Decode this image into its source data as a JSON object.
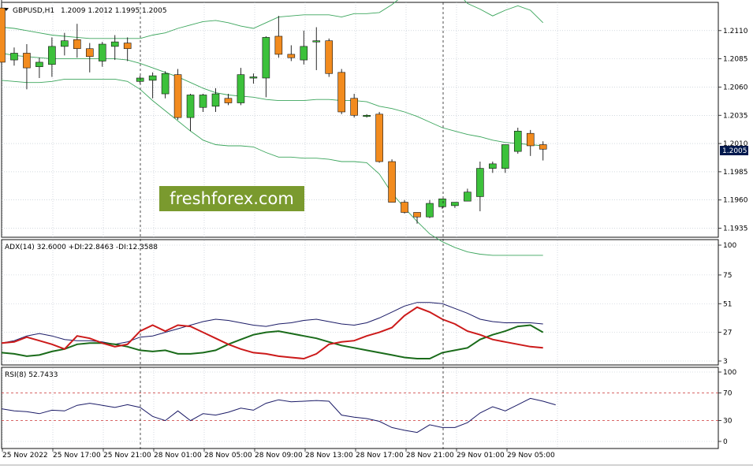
{
  "header": {
    "symbol": "GBPUSD,H1",
    "ohlc": "1.2009 1.2012 1.1995 1.2005"
  },
  "price_panel": {
    "ticks": [
      "1.2110",
      "1.2085",
      "1.2060",
      "1.2035",
      "1.2010",
      "1.1985",
      "1.1960",
      "1.1935"
    ],
    "current_price": "1.2005",
    "watermark": "freshforex.com",
    "colors": {
      "bull": "#3cc13b",
      "bear": "#f28b1e",
      "band": "#3ba55c",
      "current_tag": "#00184d"
    }
  },
  "adx_panel": {
    "label": "ADX(14) 32.6000 +DI:22.8463 -DI:12.3588",
    "ticks": [
      "100",
      "75",
      "51",
      "27",
      "3"
    ],
    "colors": {
      "adx": "#1a1a66",
      "plus_di": "#1a6b1a",
      "minus_di": "#cc1a1a"
    }
  },
  "rsi_panel": {
    "label": "RSI(8) 52.7433",
    "ticks": [
      "100",
      "70",
      "30",
      "0"
    ],
    "levels": [
      70,
      30
    ],
    "colors": {
      "line": "#1a1a66",
      "level": "#cc3333"
    }
  },
  "time_axis": [
    "25 Nov 2022",
    "25 Nov 17:00",
    "25 Nov 21:00",
    "28 Nov 01:00",
    "28 Nov 05:00",
    "28 Nov 09:00",
    "28 Nov 13:00",
    "28 Nov 17:00",
    "28 Nov 21:00",
    "29 Nov 01:00",
    "29 Nov 05:00"
  ],
  "chart_data": {
    "type": "candlestick",
    "price_ylim": [
      1.1927,
      1.2135
    ],
    "candles": [
      {
        "o": 1.213,
        "h": 1.214,
        "l": 1.2075,
        "c": 1.2082
      },
      {
        "o": 1.2084,
        "h": 1.2095,
        "l": 1.2079,
        "c": 1.209
      },
      {
        "o": 1.209,
        "h": 1.2098,
        "l": 1.2058,
        "c": 1.2077
      },
      {
        "o": 1.2078,
        "h": 1.2086,
        "l": 1.2068,
        "c": 1.2082
      },
      {
        "o": 1.208,
        "h": 1.2104,
        "l": 1.2069,
        "c": 1.2096
      },
      {
        "o": 1.2096,
        "h": 1.2108,
        "l": 1.2088,
        "c": 1.2101
      },
      {
        "o": 1.2102,
        "h": 1.2116,
        "l": 1.2086,
        "c": 1.2094
      },
      {
        "o": 1.2094,
        "h": 1.2099,
        "l": 1.2073,
        "c": 1.2087
      },
      {
        "o": 1.2083,
        "h": 1.21,
        "l": 1.2078,
        "c": 1.2098
      },
      {
        "o": 1.2096,
        "h": 1.2106,
        "l": 1.2084,
        "c": 1.21
      },
      {
        "o": 1.2099,
        "h": 1.2104,
        "l": 1.2083,
        "c": 1.2094
      },
      {
        "o": 1.2065,
        "h": 1.207,
        "l": 1.2063,
        "c": 1.2068
      },
      {
        "o": 1.2066,
        "h": 1.2073,
        "l": 1.205,
        "c": 1.207
      },
      {
        "o": 1.2054,
        "h": 1.2074,
        "l": 1.205,
        "c": 1.2072
      },
      {
        "o": 1.2071,
        "h": 1.2076,
        "l": 1.2031,
        "c": 1.2033
      },
      {
        "o": 1.2033,
        "h": 1.2054,
        "l": 1.2021,
        "c": 1.2053
      },
      {
        "o": 1.2042,
        "h": 1.2054,
        "l": 1.2038,
        "c": 1.2053
      },
      {
        "o": 1.2043,
        "h": 1.2059,
        "l": 1.2038,
        "c": 1.2054
      },
      {
        "o": 1.205,
        "h": 1.2054,
        "l": 1.2044,
        "c": 1.2046
      },
      {
        "o": 1.2046,
        "h": 1.2077,
        "l": 1.2044,
        "c": 1.2071
      },
      {
        "o": 1.2068,
        "h": 1.2072,
        "l": 1.2063,
        "c": 1.2069
      },
      {
        "o": 1.2068,
        "h": 1.2105,
        "l": 1.2051,
        "c": 1.2104
      },
      {
        "o": 1.2105,
        "h": 1.2123,
        "l": 1.2086,
        "c": 1.2089
      },
      {
        "o": 1.2089,
        "h": 1.2097,
        "l": 1.2083,
        "c": 1.2086
      },
      {
        "o": 1.2084,
        "h": 1.211,
        "l": 1.208,
        "c": 1.2096
      },
      {
        "o": 1.2101,
        "h": 1.2113,
        "l": 1.2075,
        "c": 1.2101
      },
      {
        "o": 1.2101,
        "h": 1.2103,
        "l": 1.2069,
        "c": 1.2072
      },
      {
        "o": 1.2073,
        "h": 1.2076,
        "l": 1.2036,
        "c": 1.2038
      },
      {
        "o": 1.205,
        "h": 1.2054,
        "l": 1.2033,
        "c": 1.2035
      },
      {
        "o": 1.2035,
        "h": 1.2036,
        "l": 1.2033,
        "c": 1.2035
      },
      {
        "o": 1.2036,
        "h": 1.2038,
        "l": 1.1993,
        "c": 1.1994
      },
      {
        "o": 1.1994,
        "h": 1.1996,
        "l": 1.1958,
        "c": 1.1958
      },
      {
        "o": 1.1958,
        "h": 1.196,
        "l": 1.1948,
        "c": 1.1949
      },
      {
        "o": 1.1949,
        "h": 1.1949,
        "l": 1.1939,
        "c": 1.1945
      },
      {
        "o": 1.1945,
        "h": 1.196,
        "l": 1.1944,
        "c": 1.1957
      },
      {
        "o": 1.1954,
        "h": 1.1961,
        "l": 1.1952,
        "c": 1.1961
      },
      {
        "o": 1.1955,
        "h": 1.1958,
        "l": 1.1953,
        "c": 1.1958
      },
      {
        "o": 1.1959,
        "h": 1.197,
        "l": 1.1959,
        "c": 1.1967
      },
      {
        "o": 1.1963,
        "h": 1.1994,
        "l": 1.195,
        "c": 1.1988
      },
      {
        "o": 1.1988,
        "h": 1.1994,
        "l": 1.1984,
        "c": 1.1992
      },
      {
        "o": 1.1988,
        "h": 1.2009,
        "l": 1.1984,
        "c": 1.2009
      },
      {
        "o": 1.2003,
        "h": 1.2024,
        "l": 1.2001,
        "c": 1.2021
      },
      {
        "o": 1.2019,
        "h": 1.2022,
        "l": 1.1999,
        "c": 1.2008
      },
      {
        "o": 1.2009,
        "h": 1.2012,
        "l": 1.1995,
        "c": 1.2005
      }
    ],
    "bands": {
      "upper": [
        1.2113,
        1.2112,
        1.211,
        1.2108,
        1.2106,
        1.2105,
        1.2104,
        1.2103,
        1.2103,
        1.2103,
        1.2103,
        1.2103,
        1.2106,
        1.2108,
        1.2112,
        1.2115,
        1.2118,
        1.2119,
        1.2117,
        1.2114,
        1.2112,
        1.2117,
        1.2122,
        1.2123,
        1.2124,
        1.2124,
        1.2124,
        1.2122,
        1.2125,
        1.2125,
        1.2126,
        1.2133,
        1.2142,
        1.2148,
        1.2148,
        1.2149,
        1.2146,
        1.2134,
        1.2129,
        1.2123,
        1.2128,
        1.2132,
        1.2128,
        1.2117
      ],
      "middle": [
        1.209,
        1.2088,
        1.2087,
        1.2086,
        1.2085,
        1.2085,
        1.2085,
        1.2085,
        1.2085,
        1.2085,
        1.2084,
        1.2081,
        1.2077,
        1.2073,
        1.2069,
        1.2064,
        1.2059,
        1.2055,
        1.2053,
        1.2052,
        1.2051,
        1.2049,
        1.2048,
        1.2048,
        1.2048,
        1.2049,
        1.2049,
        1.2048,
        1.2048,
        1.2047,
        1.2043,
        1.2041,
        1.2038,
        1.2034,
        1.2029,
        1.2024,
        1.2021,
        1.2018,
        1.2016,
        1.2013,
        1.2011,
        1.201,
        1.2009,
        1.2008
      ],
      "lower": [
        1.2066,
        1.2065,
        1.2064,
        1.2064,
        1.2065,
        1.2067,
        1.2067,
        1.2067,
        1.2067,
        1.2067,
        1.2065,
        1.2058,
        1.2048,
        1.2039,
        1.203,
        1.2021,
        1.2013,
        1.2009,
        1.2008,
        1.2008,
        1.2007,
        1.2002,
        1.1998,
        1.1998,
        1.1997,
        1.1997,
        1.1996,
        1.1994,
        1.1994,
        1.1993,
        1.1983,
        1.1966,
        1.1953,
        1.1941,
        1.193,
        1.1923,
        1.1918,
        1.1914,
        1.1912,
        1.1911,
        1.1911,
        1.1911,
        1.1911,
        1.1911
      ]
    },
    "adx": {
      "ylim": [
        0,
        100
      ],
      "adx": [
        18,
        20,
        24,
        26,
        24,
        21,
        20,
        20,
        19,
        17,
        19,
        23,
        24,
        27,
        30,
        33,
        36,
        38,
        37,
        35,
        33,
        32,
        34,
        35,
        37,
        38,
        36,
        34,
        33,
        35,
        39,
        44,
        49,
        52,
        52,
        51,
        47,
        43,
        38,
        36,
        35,
        35,
        35,
        34
      ],
      "plus_di": [
        10,
        9,
        7,
        8,
        11,
        13,
        17,
        18,
        18,
        17,
        15,
        12,
        11,
        12,
        9,
        9,
        10,
        12,
        17,
        21,
        25,
        27,
        28,
        26,
        24,
        22,
        19,
        16,
        14,
        12,
        10,
        8,
        6,
        5,
        5,
        10,
        12,
        14,
        21,
        25,
        28,
        32,
        33,
        27
      ],
      "minus_di": [
        18,
        19,
        23,
        20,
        17,
        13,
        24,
        22,
        18,
        15,
        17,
        28,
        33,
        28,
        33,
        32,
        27,
        22,
        17,
        13,
        10,
        9,
        7,
        6,
        5,
        9,
        17,
        19,
        20,
        24,
        27,
        31,
        41,
        48,
        44,
        38,
        34,
        28,
        25,
        21,
        19,
        17,
        15,
        14
      ]
    },
    "rsi": {
      "ylim": [
        0,
        100
      ],
      "values": [
        47,
        44,
        43,
        40,
        45,
        44,
        52,
        55,
        52,
        49,
        53,
        49,
        36,
        30,
        44,
        30,
        40,
        38,
        42,
        48,
        45,
        55,
        60,
        57,
        58,
        59,
        58,
        38,
        35,
        33,
        29,
        20,
        16,
        13,
        24,
        20,
        20,
        27,
        41,
        50,
        44,
        53,
        62,
        58,
        52.7
      ]
    }
  }
}
